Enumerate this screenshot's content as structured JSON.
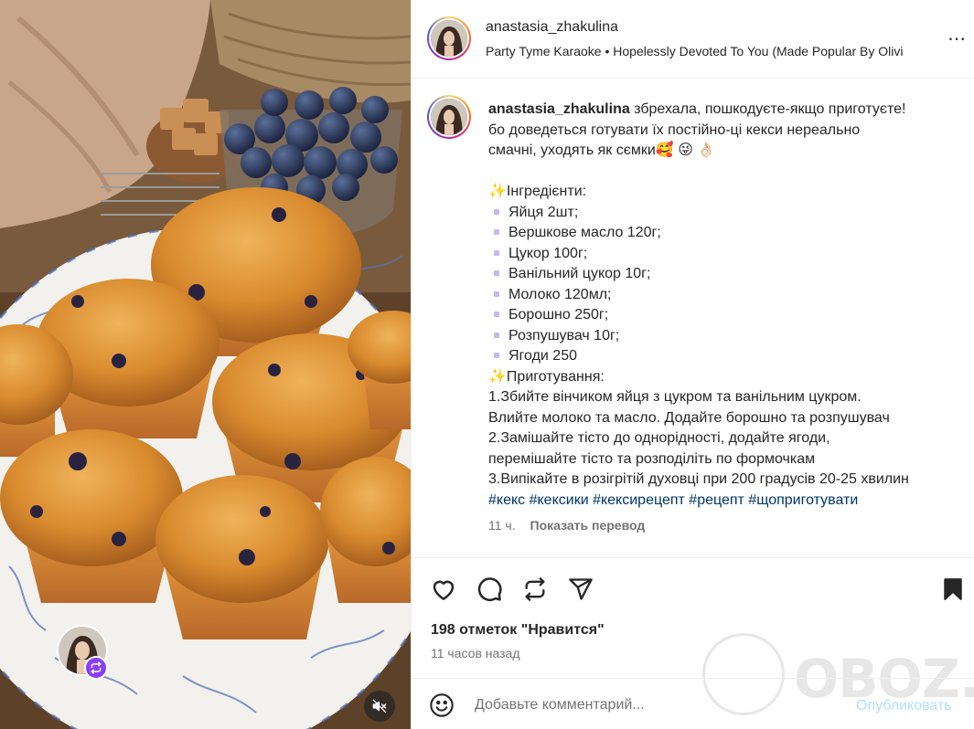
{
  "post": {
    "username": "anastasia_zhakulina",
    "music": "Party Tyme Karaoke • Hopelessly Devoted To You (Made Popular By Olivi",
    "more_icon": "⋯"
  },
  "caption": {
    "username": "anastasia_zhakulina",
    "intro_lines": [
      "збрехала, пошкодуєте-якщо приготуєте!",
      "бо доведеться готувати їх постійно-ці кекси нереально",
      "смачні, уходять як сємки🥰 😜 👌🏻"
    ],
    "ingredients_title": "✨Інгредієнти:",
    "ingredients": [
      "Яйця 2шт;",
      "Вершкове масло 120г;",
      "Цукор 100г;",
      "Ванільний цукор 10г;",
      "Молоко 120мл;",
      "Борошно 250г;",
      "Розпушувач 10г;",
      "Ягоди 250"
    ],
    "steps_title": "✨Приготування:",
    "steps_lines": [
      "1.Збийте вінчиком яйця з цукром та ванільним цукром.",
      "Влийте молоко та масло. Додайте борошно та розпушувач",
      "2.Замішайте тісто до однорідності, додайте ягоди,",
      "перемішайте тісто та розподіліть по формочкам",
      "3.Випікайте в розігрітій духовці при 200 градусів 20-25 хвилин"
    ],
    "hashtags": "#кекс #кексики #кексирецепт #рецепт #щоприготувати",
    "time_ago": "11 ч.",
    "translate_label": "Показать перевод"
  },
  "stats": {
    "likes": "198 отметок \"Нравится\"",
    "posted": "11 часов назад"
  },
  "comment": {
    "placeholder": "Добавьте комментарий...",
    "publish_label": "Опубликовать"
  },
  "watermark": {
    "text": "OBOZ.UA"
  },
  "colors": {
    "link": "#00376b",
    "secondary_text": "#737373",
    "publish_disabled": "#b2dffc",
    "repost_badge": "#8b3dff"
  },
  "icons": {
    "like": "heart-icon",
    "comment": "comment-icon",
    "repost": "repost-icon",
    "share": "share-icon",
    "save": "bookmark-icon",
    "emoji": "emoji-icon",
    "mute": "muted-speaker-icon"
  }
}
